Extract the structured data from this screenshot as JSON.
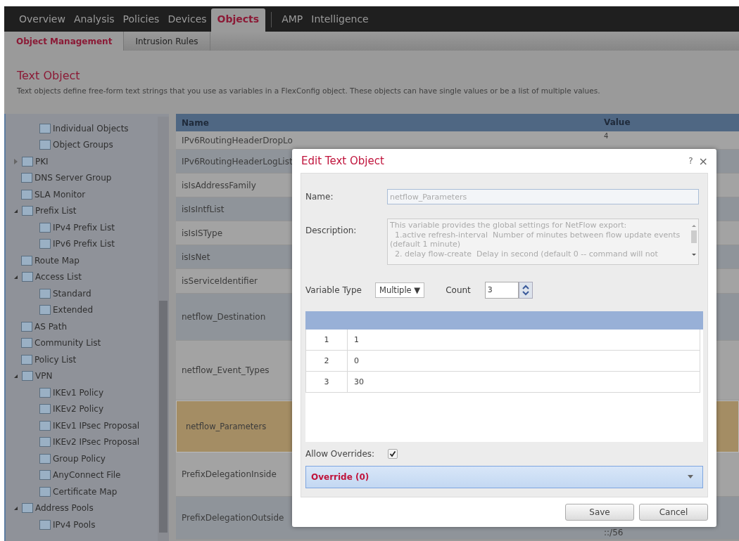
{
  "nav": {
    "tabs": [
      {
        "label": "Overview",
        "selected": false
      },
      {
        "label": "Analysis",
        "selected": false
      },
      {
        "label": "Policies",
        "selected": false
      },
      {
        "label": "Devices",
        "selected": false
      },
      {
        "label": "Objects",
        "selected": true
      },
      {
        "label": "AMP",
        "selected": false
      },
      {
        "label": "Intelligence",
        "selected": false
      }
    ]
  },
  "subnav": {
    "tabs": [
      {
        "label": "Object Management",
        "selected": true
      },
      {
        "label": "Intrusion Rules",
        "selected": false
      }
    ]
  },
  "page": {
    "title": "Text Object",
    "description": "Text objects define free-form text strings that you use as variables in a FlexConfig object. These objects can have single values or be a list of multiple values."
  },
  "sidebar": {
    "continued_children": [
      {
        "label": "Individual Objects"
      },
      {
        "label": "Object Groups"
      }
    ],
    "items": [
      {
        "label": "PKI",
        "expanded": false
      },
      {
        "label": "DNS Server Group"
      },
      {
        "label": "SLA Monitor"
      },
      {
        "label": "Prefix List",
        "expanded": true,
        "children": [
          {
            "label": "IPv4 Prefix List"
          },
          {
            "label": "IPv6 Prefix List"
          }
        ]
      },
      {
        "label": "Route Map"
      },
      {
        "label": "Access List",
        "expanded": true,
        "children": [
          {
            "label": "Standard"
          },
          {
            "label": "Extended"
          }
        ]
      },
      {
        "label": "AS Path"
      },
      {
        "label": "Community List"
      },
      {
        "label": "Policy List"
      },
      {
        "label": "VPN",
        "expanded": true,
        "children": [
          {
            "label": "IKEv1 Policy"
          },
          {
            "label": "IKEv2 Policy"
          },
          {
            "label": "IKEv1 IPsec Proposal"
          },
          {
            "label": "IKEv2 IPsec Proposal"
          },
          {
            "label": "Group Policy"
          },
          {
            "label": "AnyConnect File"
          },
          {
            "label": "Certificate Map"
          }
        ]
      },
      {
        "label": "Address Pools",
        "expanded": true,
        "children": [
          {
            "label": "IPv4 Pools"
          }
        ]
      }
    ]
  },
  "table": {
    "columns": [
      "Name",
      "Value"
    ],
    "rows": [
      {
        "name": "IPv6RoutingHeaderDropLo",
        "value": "4",
        "selected": false
      },
      {
        "name": "IPv6RoutingHeaderLogList",
        "selected": false
      },
      {
        "name": "isIsAddressFamily",
        "selected": false
      },
      {
        "name": "isIsIntfList",
        "selected": false
      },
      {
        "name": "isIsISType",
        "selected": false
      },
      {
        "name": "isIsNet",
        "selected": false
      },
      {
        "name": "isServiceIdentifier",
        "selected": false
      },
      {
        "name": "netflow_Destination",
        "selected": false
      },
      {
        "name": "netflow_Event_Types",
        "selected": false
      },
      {
        "name": "netflow_Parameters",
        "selected": true
      },
      {
        "name": "PrefixDelegationInside",
        "selected": false
      },
      {
        "name": "PrefixDelegationOutside",
        "value": "::/56",
        "selected": false
      }
    ]
  },
  "dialog": {
    "title": "Edit Text Object",
    "help": "?",
    "close": "×",
    "name_label": "Name:",
    "name_value": "netflow_Parameters",
    "description_label": "Description:",
    "description_value": "This variable provides the global settings for NetFlow export:\n  1.active refresh-interval  Number of minutes between flow update events (default 1 minute)\n  2. delay flow-create  Delay in second (default 0 -- command will not",
    "variable_type_label": "Variable Type",
    "variable_type_value": "Multiple ▼",
    "count_label": "Count",
    "count_value": "3",
    "values": [
      {
        "index": "1",
        "value": "1"
      },
      {
        "index": "2",
        "value": "0"
      },
      {
        "index": "3",
        "value": "30"
      }
    ],
    "allow_overrides_label": "Allow Overrides:",
    "allow_overrides": true,
    "override_label": "Override (0)",
    "buttons": [
      "Save",
      "Cancel"
    ]
  }
}
